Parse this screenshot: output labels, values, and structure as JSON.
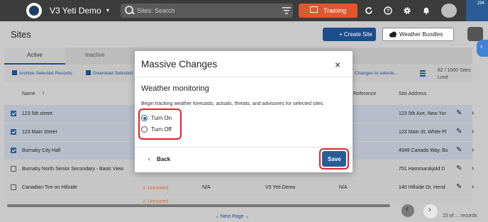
{
  "app": {
    "title": "V3 Yeti Demo",
    "caret": "▾",
    "search_placeholder": "Sites: Search",
    "training_label": "Training",
    "icons": [
      "refresh-icon",
      "help-icon",
      "gear-icon",
      "bell-icon",
      "user-avatar",
      "chat-icon"
    ],
    "chat_badge": "294",
    "accent": "#1d4d8b",
    "training_color": "#e0562e"
  },
  "page": {
    "title": "Sites",
    "create_site_label": "+ Create Site",
    "weather_bundles_label": "Weather Bundles"
  },
  "tabs": [
    "Active",
    "Inactive"
  ],
  "toolbar": {
    "archive_label": "Archive Selected Records",
    "download_label": "Download Selected",
    "changes_label": "Changes to selecte...",
    "sites_count": "82 / 1000 Sites",
    "sites_limit": "Limit"
  },
  "columns": {
    "name": "Name",
    "sort_arrow": "↑",
    "reference": "Reference",
    "address": "Site Address"
  },
  "rows": [
    {
      "name": "123 5th street",
      "address": "123 5th Ave, New Yor",
      "selected": true
    },
    {
      "name": "123 Main Street",
      "address": "123 Main St, White Pl",
      "selected": true
    },
    {
      "name": "Burnaby City Hall",
      "address": "4949 Canada Way, Bu",
      "selected": true
    },
    {
      "name": "Burnaby North Senior Secondary - Basic View",
      "address": "751 Hammarskjold D",
      "selected": false
    },
    {
      "name": "Canadian Tire on Hillside",
      "status": "⚠ Unrouted",
      "col2": "N/A",
      "col3": "V3 Yeti Demo",
      "col4": "N/A",
      "address": "140 Hillside Dr, Hend",
      "selected": false
    },
    {
      "name": "",
      "status": "⚠ Unrouted",
      "address": "",
      "selected": false
    }
  ],
  "pagination": {
    "next_page": "⌄ Next Page ⌄",
    "records": "15 of ... records"
  },
  "modal": {
    "title": "Massive Changes",
    "close": "×",
    "section_title": "Weather monitoring",
    "description": "Begin tracking weather forecasts, actuals, threats, and advisories for selected sites.",
    "options": [
      {
        "label": "Turn On",
        "selected": true
      },
      {
        "label": "Turn Off",
        "selected": false
      }
    ],
    "back_label": "Back",
    "back_icon": "‹",
    "save_label": "Save",
    "highlight_color": "#d9232d"
  }
}
